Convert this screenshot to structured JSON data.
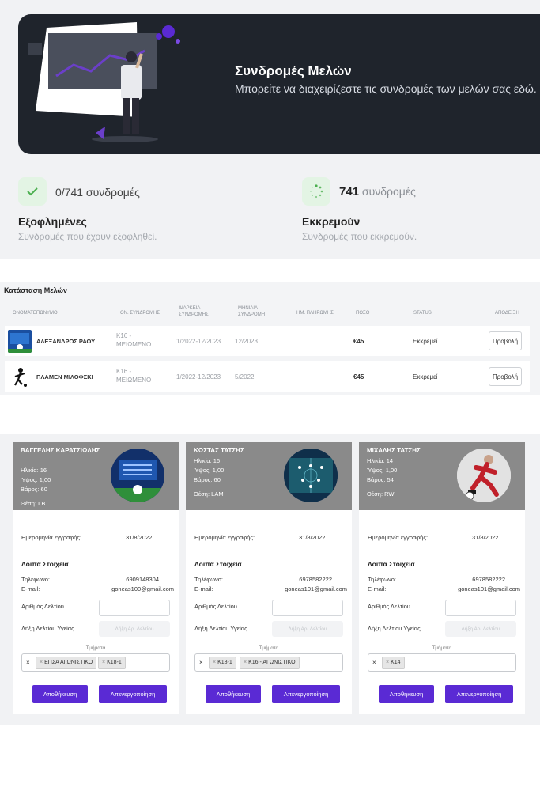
{
  "header": {
    "title": "Συνδρομές Μελών",
    "subtitle": "Μπορείτε να διαχειρίζεστε τις συνδρομές των μελών σας εδώ."
  },
  "stats": [
    {
      "count_text": "0/741 συνδρομές",
      "title": "Εξοφλημένες",
      "description": "Συνδρομές που έχουν εξοφληθεί.",
      "icon": "check-icon"
    },
    {
      "count_number": "741",
      "count_unit": "συνδρομές",
      "title": "Εκκρεμούν",
      "description": "Συνδρομές που εκκρεμούν.",
      "icon": "spinner-icon"
    }
  ],
  "members_table": {
    "title": "Κατάσταση Μελών",
    "columns": [
      "ΟΝΟΜΑΤΕΠΩΝΥΜΟ",
      "ΟΝ. ΣΥΝΔΡΟΜΗΣ",
      "ΔΙΑΡΚΕΙΑ ΣΥΝΔΡΟΜΗΣ",
      "ΜΗΝΙΑΙΑ ΣΥΝΔΡΟΜΗ",
      "ΗΜ. ΠΛΗΡΩΜΗΣ",
      "ΠΟΣΟ",
      "STATUS",
      "ΑΠΟΔΕΙΞΗ"
    ],
    "rows": [
      {
        "name": "ΑΛΕΞΑΝΔΡΟΣ ΡΑΟΥ",
        "subscription": "Κ16 - ΜΕΙΩΜΕΝΟ",
        "duration": "1/2022-12/2023",
        "monthly": "12/2023",
        "payment_date": "",
        "amount": "€45",
        "status": "Εκκρεμεί",
        "action": "Προβολή"
      },
      {
        "name": "ΠΛΑΜΕΝ ΜΙΛΟΦΣΚΙ",
        "subscription": "Κ16 - ΜΕΙΩΜΕΝΟ",
        "duration": "1/2022-12/2023",
        "monthly": "5/2022",
        "payment_date": "",
        "amount": "€45",
        "status": "Εκκρεμεί",
        "action": "Προβολή"
      }
    ]
  },
  "cards_labels": {
    "registration_date": "Ημερομηνία εγγραφής:",
    "other_info": "Λοιπά Στοιχεία",
    "phone": "Τηλέφωνο:",
    "email": "E-mail:",
    "card_number": "Αριθμός Δελτίου",
    "health_card_expiry": "Λήξη Δελτίου Υγείας",
    "health_placeholder": "Λήξη Αρ. Δελτίου",
    "departments": "Τμήματα",
    "save": "Αποθήκευση",
    "deactivate": "Απενεργοποίηση",
    "clear_all": "×"
  },
  "players": [
    {
      "name": "ΒΑΓΓΕΛΗΣ ΚΑΡΑΤΣΙΩΛΗΣ",
      "age": "Ηλικία: 16",
      "height": "Ύψος: 1,00",
      "weight": "Βάρος: 60",
      "position": "Θέση: LB",
      "registration_date": "31/8/2022",
      "phone": "6909148304",
      "email": "goneas100@gmail.com",
      "departments": [
        "ΕΠΣΑ ΑΓΩΝΙΣΤΙΚΟ",
        "Κ18-1"
      ]
    },
    {
      "name": "ΚΩΣΤΑΣ ΤΑΤΣΗΣ",
      "age": "Ηλικία: 16",
      "height": "Ύψος: 1,00",
      "weight": "Βάρος: 60",
      "position": "Θέση: LAM",
      "registration_date": "31/8/2022",
      "phone": "6978582222",
      "email": "goneas101@gmail.com",
      "departments": [
        "Κ18-1",
        "Κ16 - ΑΓΩΝΙΣΤΙΚΟ"
      ]
    },
    {
      "name": "ΜΙΧΑΛΗΣ ΤΑΤΣΗΣ",
      "age": "Ηλικία: 14",
      "height": "Ύψος: 1,00",
      "weight": "Βάρος: 54",
      "position": "Θέση: RW",
      "registration_date": "31/8/2022",
      "phone": "6978582222",
      "email": "goneas101@gmail.com",
      "departments": [
        "Κ14"
      ]
    }
  ],
  "colors": {
    "hero_bg": "#1f242c",
    "accent_purple": "#5a2ad4",
    "card_header": "#8a8a8a",
    "success_bg": "#e3f4e4",
    "success": "#4caf50"
  }
}
